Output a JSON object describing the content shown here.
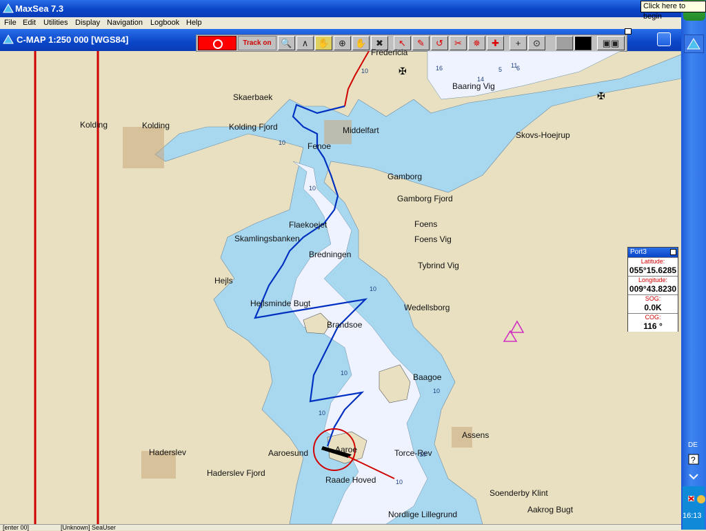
{
  "window": {
    "title": "MaxSea 7.3",
    "tooltip": "Click here to begin"
  },
  "menu": [
    "File",
    "Edit",
    "Utilities",
    "Display",
    "Navigation",
    "Logbook",
    "Help"
  ],
  "chart_window": {
    "title": "C-MAP  1:250 000 [WGS84]"
  },
  "toolbar": {
    "track_label": "Track on",
    "tools": [
      "zoom-icon",
      "compass-icon",
      "hand-icon",
      "target-icon",
      "move-hand-icon",
      "route-icon",
      "pointer-icon",
      "pencil-icon",
      "tide-icon",
      "scissors-icon",
      "waypoint-icon",
      "pan-icon",
      "plus-icon",
      "circle-target-icon",
      "blank",
      "black-box",
      "display-icon"
    ]
  },
  "places": [
    {
      "name": "Fredericia"
    },
    {
      "name": "Baaring Vig"
    },
    {
      "name": "Skaerbaek"
    },
    {
      "name": "Kolding"
    },
    {
      "name": "Kolding"
    },
    {
      "name": "Kolding Fjord"
    },
    {
      "name": "Middelfart"
    },
    {
      "name": "Fenoe"
    },
    {
      "name": "Skovs-Hoejrup"
    },
    {
      "name": "Gamborg"
    },
    {
      "name": "Gamborg Fjord"
    },
    {
      "name": "Foens"
    },
    {
      "name": "Foens Vig"
    },
    {
      "name": "Flaekoejet"
    },
    {
      "name": "Skamlingsbanken"
    },
    {
      "name": "Bredningen"
    },
    {
      "name": "Tybrind Vig"
    },
    {
      "name": "Hejls"
    },
    {
      "name": "Hejlsminde Bugt"
    },
    {
      "name": "Wedellsborg"
    },
    {
      "name": "Brandsoe"
    },
    {
      "name": "Baagoe"
    },
    {
      "name": "Assens"
    },
    {
      "name": "Haderslev"
    },
    {
      "name": "Aaroesund"
    },
    {
      "name": "Aaroe"
    },
    {
      "name": "Torce-Rev"
    },
    {
      "name": "Haderslev Fjord"
    },
    {
      "name": "Raade Hoved"
    },
    {
      "name": "Soenderby Klint"
    },
    {
      "name": "Aakrog Bugt"
    },
    {
      "name": "Nordlige Lillegrund"
    }
  ],
  "depths": [
    "16",
    "14",
    "11",
    "6",
    "5",
    "10",
    "10",
    "10",
    "10",
    "10",
    "10",
    "10",
    "10",
    "10"
  ],
  "infobox": {
    "title": "Port3",
    "latitude_label": "Latitude:",
    "latitude": "055°15.6285",
    "longitude_label": "Longitude:",
    "longitude": "009°43.8230",
    "sog_label": "SOG:",
    "sog": "0.0K",
    "cog_label": "COG:",
    "cog": "116 °"
  },
  "statusbar": {
    "left": "[enter 00]",
    "middle": "[Unknown] SeaUser"
  },
  "taskbar": {
    "lang": "DE",
    "clock": "16:13"
  },
  "colors": {
    "land": "#e8e0c0",
    "shallow": "#a8d8f0",
    "deep": "#f0f4ff",
    "track": "#0030c0",
    "route": "#d00000"
  }
}
